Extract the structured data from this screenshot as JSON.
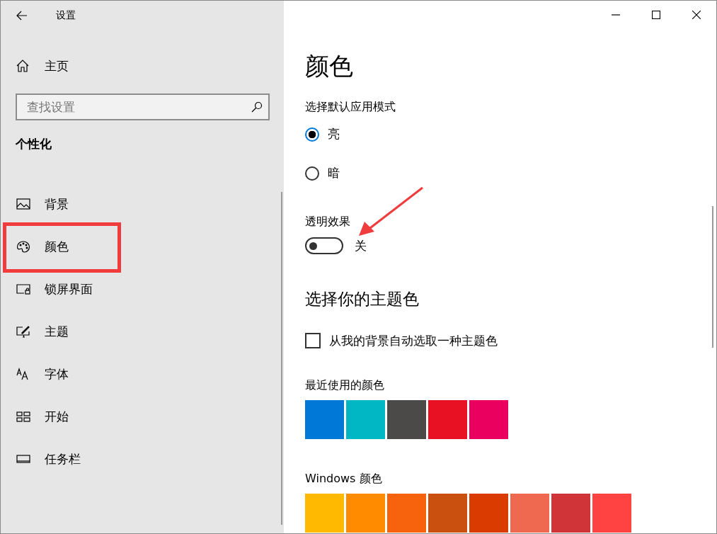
{
  "window": {
    "title": "设置"
  },
  "sidebar": {
    "home": "主页",
    "search": {
      "placeholder": "查找设置"
    },
    "section": "个性化",
    "items": [
      {
        "label": "背景"
      },
      {
        "label": "颜色"
      },
      {
        "label": "锁屏界面"
      },
      {
        "label": "主题"
      },
      {
        "label": "字体"
      },
      {
        "label": "开始"
      },
      {
        "label": "任务栏"
      }
    ]
  },
  "page": {
    "title": "颜色",
    "mode_heading": "选择默认应用模式",
    "modes": [
      {
        "label": "亮",
        "selected": true
      },
      {
        "label": "暗",
        "selected": false
      }
    ],
    "transparency": {
      "label": "透明效果",
      "on": false,
      "state_text": "关"
    },
    "accent_heading": "选择你的主题色",
    "auto_accent": {
      "label": "从我的背景自动选取一种主题色",
      "checked": false
    },
    "recent_heading": "最近使用的颜色",
    "recent_colors": [
      {
        "color": "#0078d7"
      },
      {
        "color": "#00b7c3"
      },
      {
        "color": "#4c4a48"
      },
      {
        "color": "#e81123"
      },
      {
        "color": "#ea005e"
      }
    ],
    "windows_heading": "Windows 颜色",
    "windows_colors": [
      {
        "color": "#ffb900"
      },
      {
        "color": "#ff8c00"
      },
      {
        "color": "#f7630c"
      },
      {
        "color": "#ca5010"
      },
      {
        "color": "#da3b01"
      },
      {
        "color": "#ef6950"
      },
      {
        "color": "#d13438"
      },
      {
        "color": "#ff4343"
      }
    ]
  },
  "annotations": {
    "highlight_frame": true,
    "arrow": true
  }
}
